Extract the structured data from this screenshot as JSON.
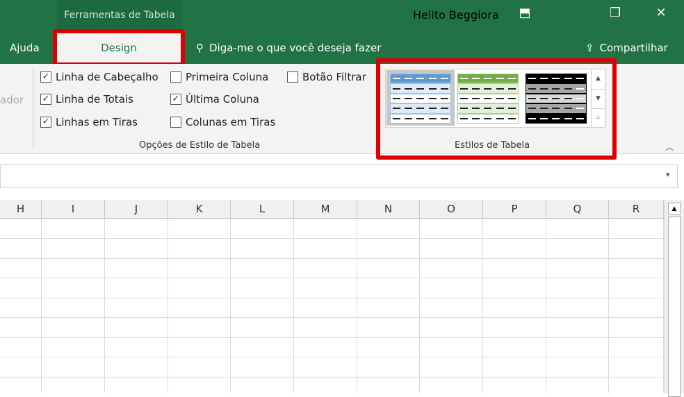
{
  "titlebar": {
    "context_tab": "Ferramentas de Tabela",
    "user": "Helito Beggiora",
    "ribbon_display_icon": "⬒",
    "restore_icon": "❐",
    "close_icon": "✕"
  },
  "tabs": {
    "ajuda": "Ajuda",
    "design": "Design",
    "tell_me": "Diga-me o que você deseja fazer",
    "share": "Compartilhar"
  },
  "ribbon": {
    "cut_label": "ador",
    "options": [
      {
        "label": "Linha de Cabeçalho",
        "checked": true
      },
      {
        "label": "Linha de Totais",
        "checked": true
      },
      {
        "label": "Linhas em Tiras",
        "checked": true
      },
      {
        "label": "Primeira Coluna",
        "checked": false
      },
      {
        "label": "Última Coluna",
        "checked": true
      },
      {
        "label": "Colunas em Tiras",
        "checked": false
      },
      {
        "label": "Botão Filtrar",
        "checked": false
      }
    ],
    "options_group": "Opções de Estilo de Tabela",
    "styles_group": "Estilos de Tabela",
    "styles": [
      {
        "name": "blue",
        "header": "#5b9bd5",
        "band": "#ddebf7",
        "border": "#9dc3e6"
      },
      {
        "name": "green",
        "header": "#70ad47",
        "band": "#e2efda",
        "border": "#a9d08e"
      },
      {
        "name": "black",
        "header": "#000000",
        "band": "#a6a6a6",
        "border": "#000000"
      }
    ]
  },
  "columns": [
    "H",
    "I",
    "J",
    "K",
    "L",
    "M",
    "N",
    "O",
    "P",
    "Q",
    "R"
  ]
}
